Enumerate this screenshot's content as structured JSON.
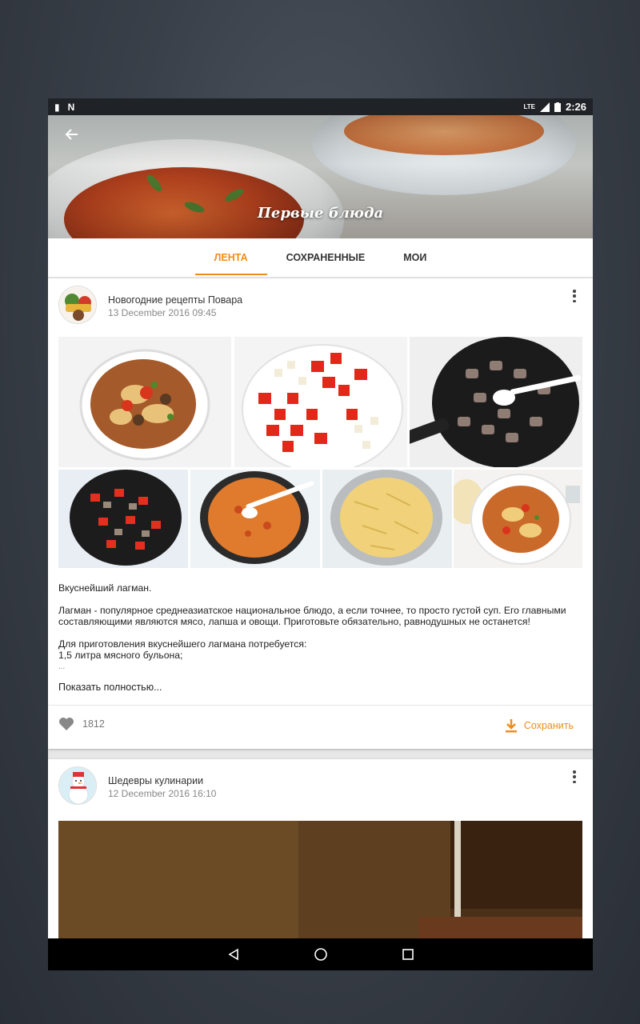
{
  "status_bar": {
    "time": "2:26",
    "network": "LTE"
  },
  "header": {
    "title": "Первые блюда",
    "back_icon": "arrow-left-icon"
  },
  "tabs": [
    {
      "label": "ЛЕНТА",
      "active": true
    },
    {
      "label": "СОХРАНЕННЫЕ",
      "active": false
    },
    {
      "label": "МОИ",
      "active": false
    }
  ],
  "posts": [
    {
      "author": "Новогодние рецепты Повара",
      "date": "13 December 2016  09:45",
      "paragraphs": [
        "Вкуснейший лагман.",
        "Лагман - популярное среднеазиатское национальное блюдо, а если точнее, то просто густой суп. Его главными составляющими являются мясо, лапша и овощи. Приготовьте обязательно, равнодушных не останется!",
        "Для приготовления вкуснейшего лагмана потребуется:",
        "1,5 литра мясного бульона;"
      ],
      "ellipsis": "...",
      "show_more": "Показать полностью...",
      "likes": "1812",
      "save_label": "Сохранить"
    },
    {
      "author": "Шедевры кулинарии",
      "date": "12 December 2016  16:10"
    }
  ],
  "colors": {
    "accent": "#f08c1a"
  }
}
